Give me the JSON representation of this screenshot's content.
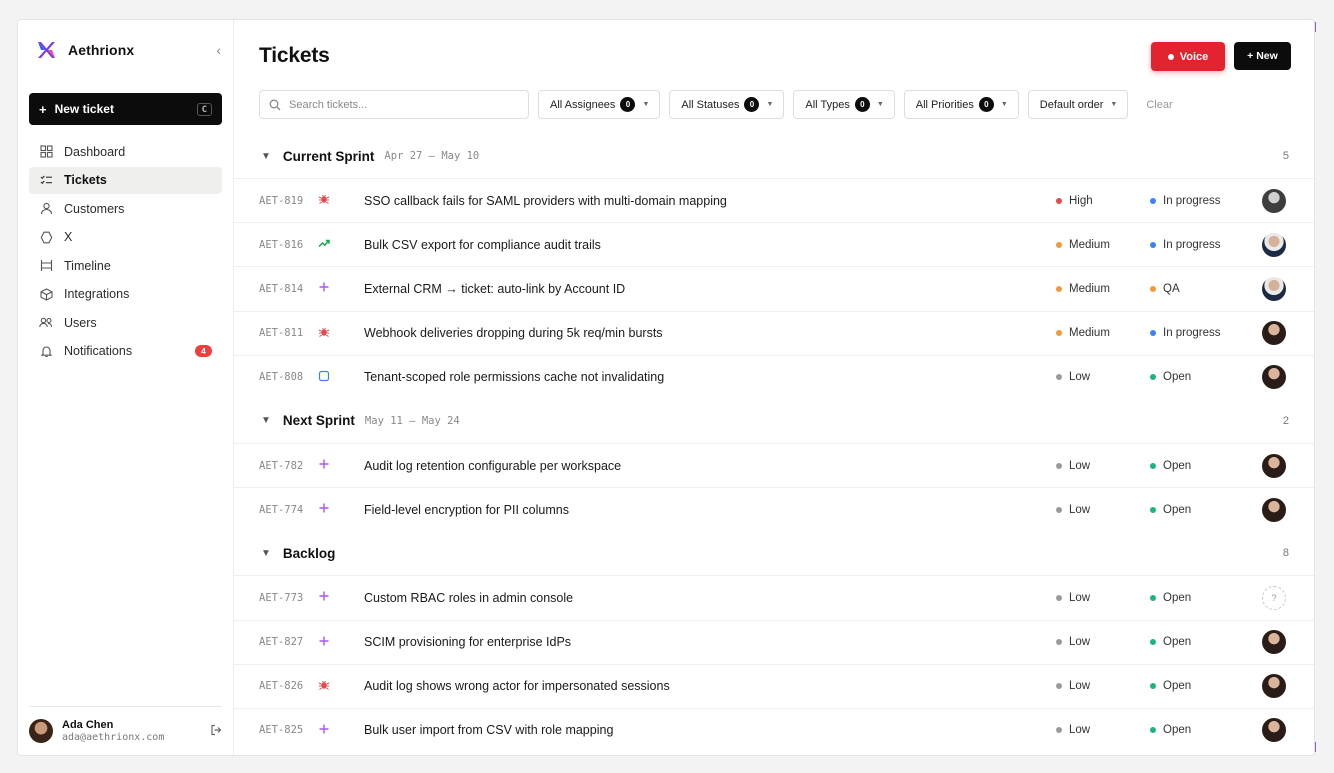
{
  "app": {
    "name": "Aethrionx"
  },
  "sidebar": {
    "new_ticket": {
      "label": "New ticket",
      "shortcut": "C"
    },
    "items": [
      {
        "label": "Dashboard",
        "icon": "dashboard-icon",
        "active": false
      },
      {
        "label": "Tickets",
        "icon": "tickets-icon",
        "active": true
      },
      {
        "label": "Customers",
        "icon": "user-icon",
        "active": false
      },
      {
        "label": "X",
        "icon": "hexagon-icon",
        "active": false
      },
      {
        "label": "Timeline",
        "icon": "timeline-icon",
        "active": false
      },
      {
        "label": "Integrations",
        "icon": "cube-icon",
        "active": false
      },
      {
        "label": "Users",
        "icon": "users-icon",
        "active": false
      },
      {
        "label": "Notifications",
        "icon": "bell-icon",
        "active": false,
        "badge": "4"
      }
    ],
    "user": {
      "name": "Ada Chen",
      "email": "ada@aethrionx.com"
    }
  },
  "header": {
    "title": "Tickets",
    "voice_label": "Voice",
    "new_label": "+ New"
  },
  "filters": {
    "search_placeholder": "Search tickets...",
    "assignees": {
      "label": "All Assignees",
      "count": "0"
    },
    "statuses": {
      "label": "All Statuses",
      "count": "0"
    },
    "types": {
      "label": "All Types",
      "count": "0"
    },
    "priorities": {
      "label": "All Priorities",
      "count": "0"
    },
    "order": {
      "label": "Default order"
    },
    "clear_label": "Clear"
  },
  "colors": {
    "high": "#e5484d",
    "medium": "#f29a38",
    "low": "#9a9a9a",
    "in_progress": "#3b82f6",
    "qa": "#f29a38",
    "open": "#16b77a",
    "bug": "#e5484d",
    "feature": "#a855f7",
    "improvement": "#16a34a",
    "task": "#3b82f6",
    "voice": "#e3232f"
  },
  "groups": [
    {
      "name": "Current Sprint",
      "dates": "Apr 27 — May 10",
      "count": "5",
      "tickets": [
        {
          "id": "AET-819",
          "type": "bug",
          "title": "SSO callback fails for SAML providers with multi-domain mapping",
          "priority": "High",
          "status": "In progress",
          "avatar": "gray"
        },
        {
          "id": "AET-816",
          "type": "improvement",
          "title": "Bulk CSV export for compliance audit trails",
          "priority": "Medium",
          "status": "In progress",
          "avatar": "man"
        },
        {
          "id": "AET-814",
          "type": "feature",
          "title": "External CRM → ticket: auto-link by Account ID",
          "priority": "Medium",
          "status": "QA",
          "avatar": "man"
        },
        {
          "id": "AET-811",
          "type": "bug",
          "title": "Webhook deliveries dropping during 5k req/min bursts",
          "priority": "Medium",
          "status": "In progress",
          "avatar": "dark"
        },
        {
          "id": "AET-808",
          "type": "task",
          "title": "Tenant-scoped role permissions cache not invalidating",
          "priority": "Low",
          "status": "Open",
          "avatar": "dark"
        }
      ]
    },
    {
      "name": "Next Sprint",
      "dates": "May 11 — May 24",
      "count": "2",
      "tickets": [
        {
          "id": "AET-782",
          "type": "feature",
          "title": "Audit log retention configurable per workspace",
          "priority": "Low",
          "status": "Open",
          "avatar": "dark"
        },
        {
          "id": "AET-774",
          "type": "feature",
          "title": "Field-level encryption for PII columns",
          "priority": "Low",
          "status": "Open",
          "avatar": "dark"
        }
      ]
    },
    {
      "name": "Backlog",
      "dates": "",
      "count": "8",
      "tickets": [
        {
          "id": "AET-773",
          "type": "feature",
          "title": "Custom RBAC roles in admin console",
          "priority": "Low",
          "status": "Open",
          "avatar": "unknown"
        },
        {
          "id": "AET-827",
          "type": "feature",
          "title": "SCIM provisioning for enterprise IdPs",
          "priority": "Low",
          "status": "Open",
          "avatar": "dark"
        },
        {
          "id": "AET-826",
          "type": "bug",
          "title": "Audit log shows wrong actor for impersonated sessions",
          "priority": "Low",
          "status": "Open",
          "avatar": "dark"
        },
        {
          "id": "AET-825",
          "type": "feature",
          "title": "Bulk user import from CSV with role mapping",
          "priority": "Low",
          "status": "Open",
          "avatar": "dark"
        }
      ]
    }
  ]
}
